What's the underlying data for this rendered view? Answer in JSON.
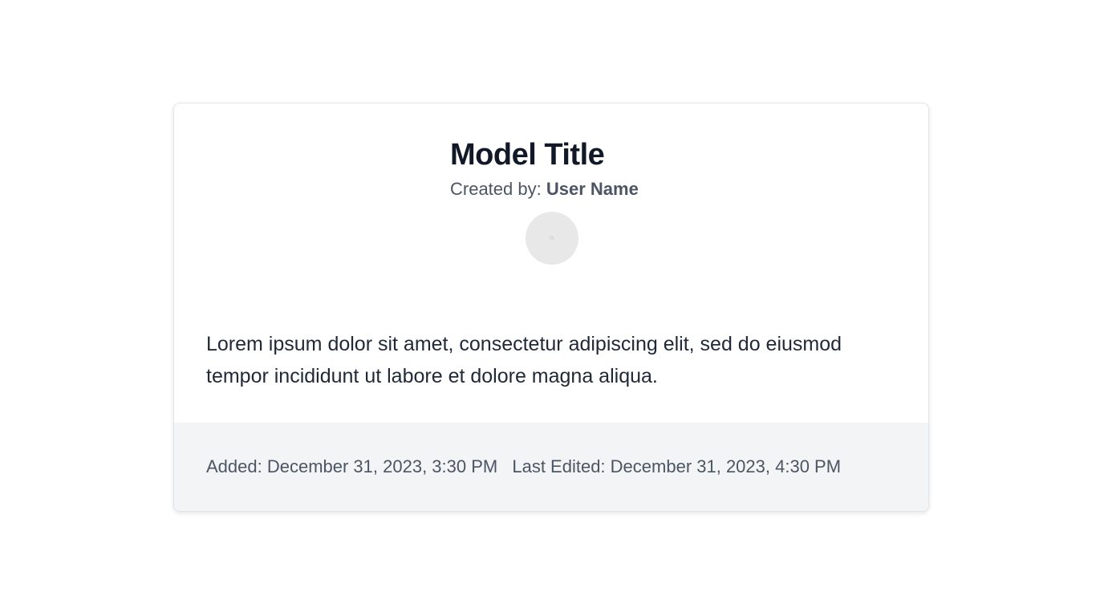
{
  "model": {
    "title": "Model Title",
    "created_by_label": "Created by:",
    "user_name": "User Name",
    "description": "Lorem ipsum dolor sit amet, consectetur adipiscing elit, sed do eiusmod tempor incididunt ut labore et dolore magna aliqua."
  },
  "footer": {
    "added": "Added: December 31, 2023, 3:30 PM",
    "last_edited": "Last Edited: December 31, 2023, 4:30 PM"
  },
  "colors": {
    "title": "#111827",
    "muted": "#4b5563",
    "footer_bg": "#f3f4f6",
    "avatar_bg": "#e8e8e8"
  },
  "icons": {
    "avatar": "avatar-placeholder-icon"
  }
}
